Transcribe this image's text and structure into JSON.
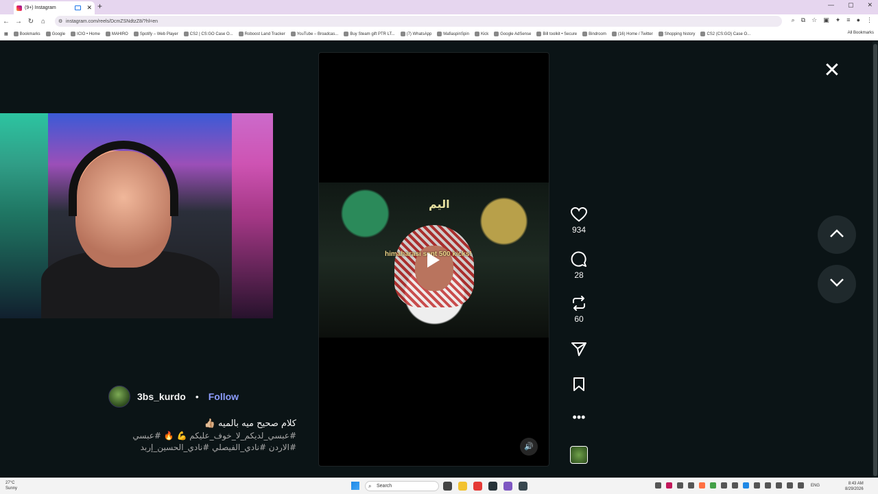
{
  "browser": {
    "tab_title": "(9+) Instagram",
    "new_tab": "+",
    "url": "instagram.com/reels/DcmZSNdtzZ8/?hl=en",
    "bookmarks": [
      "Bookmarks",
      "Google",
      "ICIO • Home",
      "MAHIRO",
      "Spotify – Web Player",
      "CS2 | CS:GO Case O...",
      "Roboost Land Tracker",
      "YouTube – Broadcas...",
      "Buy Steam gift PTR LT...",
      "(7) WhatsApp",
      "MafiaspinSpin",
      "Kick",
      "Google AdSense",
      "Bill toolkit • Secure",
      "Bindroom",
      "(16) Home / Twitter",
      "Shopping history",
      "CS2 (CS:GO) Case O..."
    ],
    "all_bookmarks": "All Bookmarks"
  },
  "reel": {
    "overlay_text": "himaharasi sent 500 kicks!",
    "sign_text": "اليم",
    "likes": "934",
    "comments": "28",
    "reposts": "60"
  },
  "author": {
    "username": "3bs_kurdo",
    "separator": "•",
    "follow_label": "Follow"
  },
  "description": {
    "line1": "كلام صحيح ميه بالميه 👍🏼",
    "line2": "#عبسي_لديكم_لا_خوف_عليكم 💪 🔥 #عبسي",
    "line3": "#الاردن #نادي_الفيصلي #نادي_الحسين_إربد"
  },
  "taskbar": {
    "weather_temp": "27°C",
    "weather_desc": "Sunny",
    "search_label": "Search",
    "lang": "ENG",
    "time": "8:43 AM",
    "date": "8/29/2026"
  }
}
